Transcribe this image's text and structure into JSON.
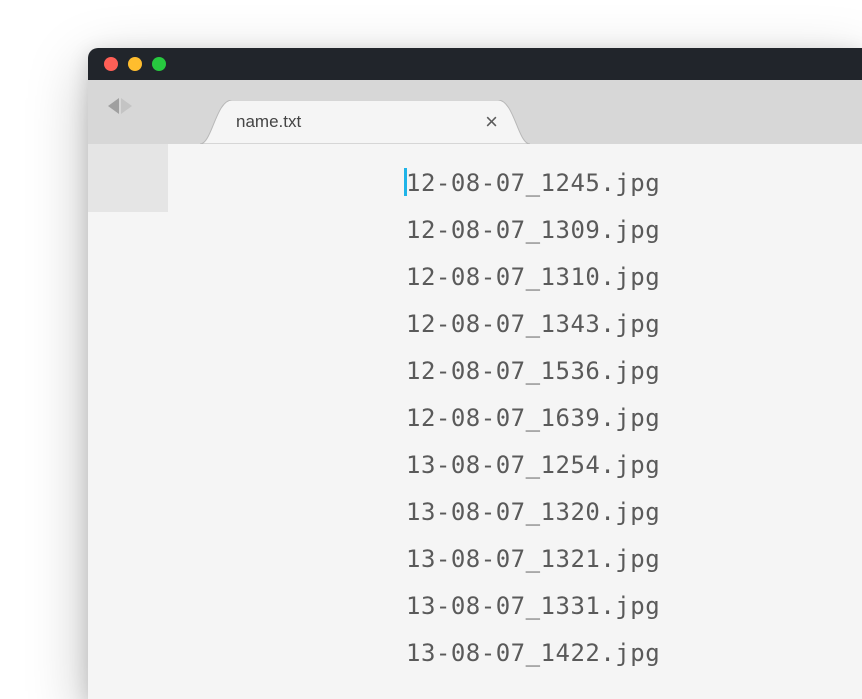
{
  "tab": {
    "label": "name.txt"
  },
  "lines": [
    "12-08-07_1245.jpg",
    "12-08-07_1309.jpg",
    "12-08-07_1310.jpg",
    "12-08-07_1343.jpg",
    "12-08-07_1536.jpg",
    "12-08-07_1639.jpg",
    "13-08-07_1254.jpg",
    "13-08-07_1320.jpg",
    "13-08-07_1321.jpg",
    "13-08-07_1331.jpg",
    "13-08-07_1422.jpg"
  ]
}
